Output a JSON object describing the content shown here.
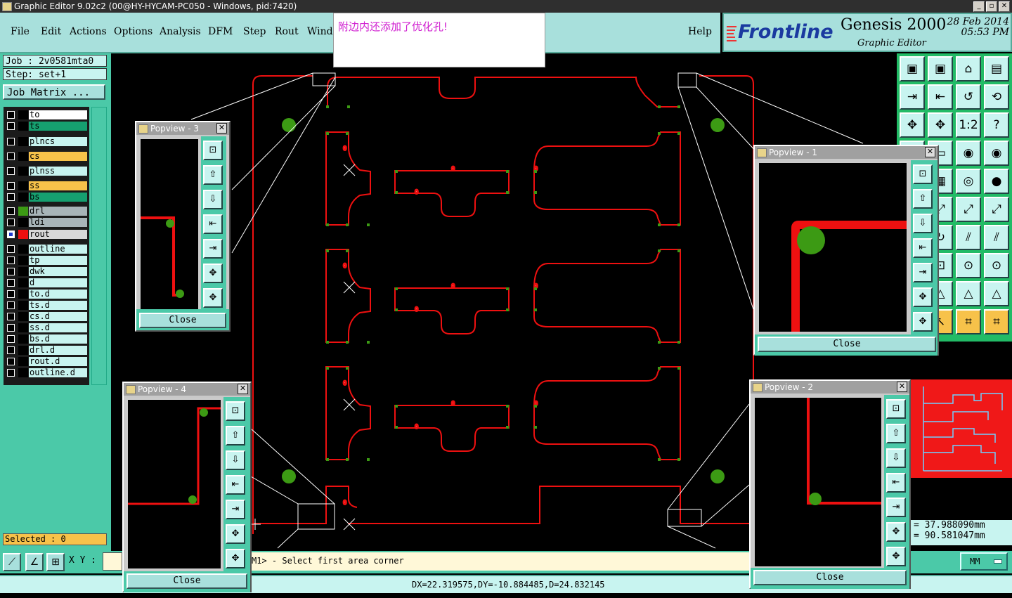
{
  "window": {
    "title": "Graphic Editor 9.02c2 (00@HY-HYCAM-PC050 - Windows, pid:7420)"
  },
  "menu": {
    "items": [
      "File",
      "Edit",
      "Actions",
      "Options",
      "Analysis",
      "DFM",
      "Step",
      "Rout",
      "Windo",
      "Help"
    ]
  },
  "tooltip": "附边内还添加了优化孔!",
  "logo": {
    "brand": "Frontline",
    "product": "Genesis 2000",
    "subtitle": "Graphic Editor",
    "date": "28 Feb 2014",
    "time": "05:53 PM"
  },
  "job": {
    "job_label": "Job : 2v0581mta0",
    "step_label": "Step: set+1",
    "matrix_button": "Job Matrix ..."
  },
  "layers": [
    {
      "name": "to",
      "color": "#ffffff",
      "swatch": "#ffffff",
      "selected": false
    },
    {
      "name": "ts",
      "color": "#16a070",
      "swatch": "#16a070",
      "selected": false
    },
    {
      "name": "plncs",
      "color": "#c8f4f0",
      "swatch": "#c8f4f0",
      "selected": false
    },
    {
      "name": "cs",
      "color": "#f7c24a",
      "swatch": "#f7c24a",
      "selected": false
    },
    {
      "name": "plnss",
      "color": "#c8f4f0",
      "swatch": "#c8f4f0",
      "selected": false
    },
    {
      "name": "ss",
      "color": "#f7c24a",
      "swatch": "#f7c24a",
      "selected": false
    },
    {
      "name": "bs",
      "color": "#16a070",
      "swatch": "#16a070",
      "selected": false
    },
    {
      "name": "drl",
      "color": "#a8b4b8",
      "swatch": "#3c9a14",
      "selected": false
    },
    {
      "name": "ldi",
      "color": "#a8b4b8",
      "swatch": "#a8b4b8",
      "selected": false
    },
    {
      "name": "rout",
      "color": "#d8d8d8",
      "swatch": "#ee1010",
      "selected": true
    },
    {
      "name": "outline",
      "color": "#c8f4f0",
      "swatch": "#c8f4f0",
      "selected": false
    },
    {
      "name": "tp",
      "color": "#c8f4f0",
      "swatch": "#c8f4f0",
      "selected": false
    },
    {
      "name": "dwk",
      "color": "#c8f4f0",
      "swatch": "#c8f4f0",
      "selected": false
    },
    {
      "name": "d",
      "color": "#c8f4f0",
      "swatch": "#c8f4f0",
      "selected": false
    },
    {
      "name": "to.d",
      "color": "#c8f4f0",
      "swatch": "#c8f4f0",
      "selected": false
    },
    {
      "name": "ts.d",
      "color": "#c8f4f0",
      "swatch": "#c8f4f0",
      "selected": false
    },
    {
      "name": "cs.d",
      "color": "#c8f4f0",
      "swatch": "#c8f4f0",
      "selected": false
    },
    {
      "name": "ss.d",
      "color": "#c8f4f0",
      "swatch": "#c8f4f0",
      "selected": false
    },
    {
      "name": "bs.d",
      "color": "#c8f4f0",
      "swatch": "#c8f4f0",
      "selected": false
    },
    {
      "name": "drl.d",
      "color": "#c8f4f0",
      "swatch": "#c8f4f0",
      "selected": false
    },
    {
      "name": "rout.d",
      "color": "#c8f4f0",
      "swatch": "#c8f4f0",
      "selected": false
    },
    {
      "name": "outline.d",
      "color": "#c8f4f0",
      "swatch": "#c8f4f0",
      "selected": false
    }
  ],
  "selected_label": "Selected : 0",
  "xy_label": "X Y :",
  "command_prompt": "M1> - Select first area corner",
  "coords": {
    "x": "= 37.988090mm",
    "y": "= 90.581047mm"
  },
  "units": "MM",
  "status": "DX=22.319575,DY=-10.884485,D=24.832145",
  "popviews": [
    {
      "title": "Popview - 3",
      "close": "Close"
    },
    {
      "title": "Popview - 1",
      "close": "Close"
    },
    {
      "title": "Popview - 4",
      "close": "Close"
    },
    {
      "title": "Popview - 2",
      "close": "Close"
    }
  ],
  "toolbox_buttons": [
    "1:2",
    "?"
  ],
  "colors": {
    "rout": "#ee1010",
    "drill": "#3c9a14",
    "panel": "#4bc9a8",
    "button": "#c8f4f0"
  }
}
